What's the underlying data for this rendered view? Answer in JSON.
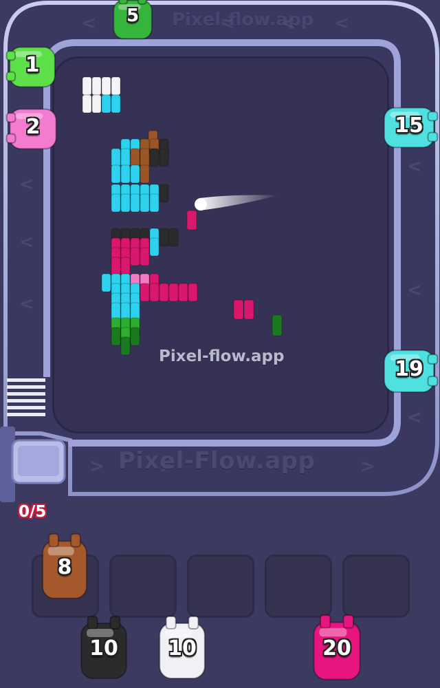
{
  "watermark": {
    "board": "Pixel-flow.app",
    "track": "Pixel-Flow.app",
    "top": "Pixel-flow.app"
  },
  "counter": "0/5",
  "track_shooters": [
    {
      "id": "green-top",
      "color": "#36b53c",
      "ammo": "5"
    },
    {
      "id": "green-left",
      "color": "#5ee04b",
      "ammo": "1"
    },
    {
      "id": "pink-left",
      "color": "#f37bd0",
      "ammo": "2"
    },
    {
      "id": "cyan-right-upper",
      "color": "#4fe0e0",
      "ammo": "15"
    },
    {
      "id": "cyan-right-lower",
      "color": "#4fe0e0",
      "ammo": "19"
    }
  ],
  "queue_shooters": [
    {
      "id": "brown",
      "color": "#a4582c",
      "ammo": "8"
    },
    {
      "id": "black",
      "color": "#2b2b2e",
      "ammo": "10"
    },
    {
      "id": "white",
      "color": "#f1f1f5",
      "ammo": "10"
    },
    {
      "id": "magenta",
      "color": "#e6157f",
      "ammo": "20"
    }
  ],
  "palette": {
    "white": "#f4f4f6",
    "cyan": "#2fd2ee",
    "brown": "#9a5528",
    "black": "#2b2b2e",
    "magenta": "#d8176d",
    "pink": "#f07bc2",
    "green": "#2eae2f",
    "darkgreen": "#1b7a1f"
  }
}
